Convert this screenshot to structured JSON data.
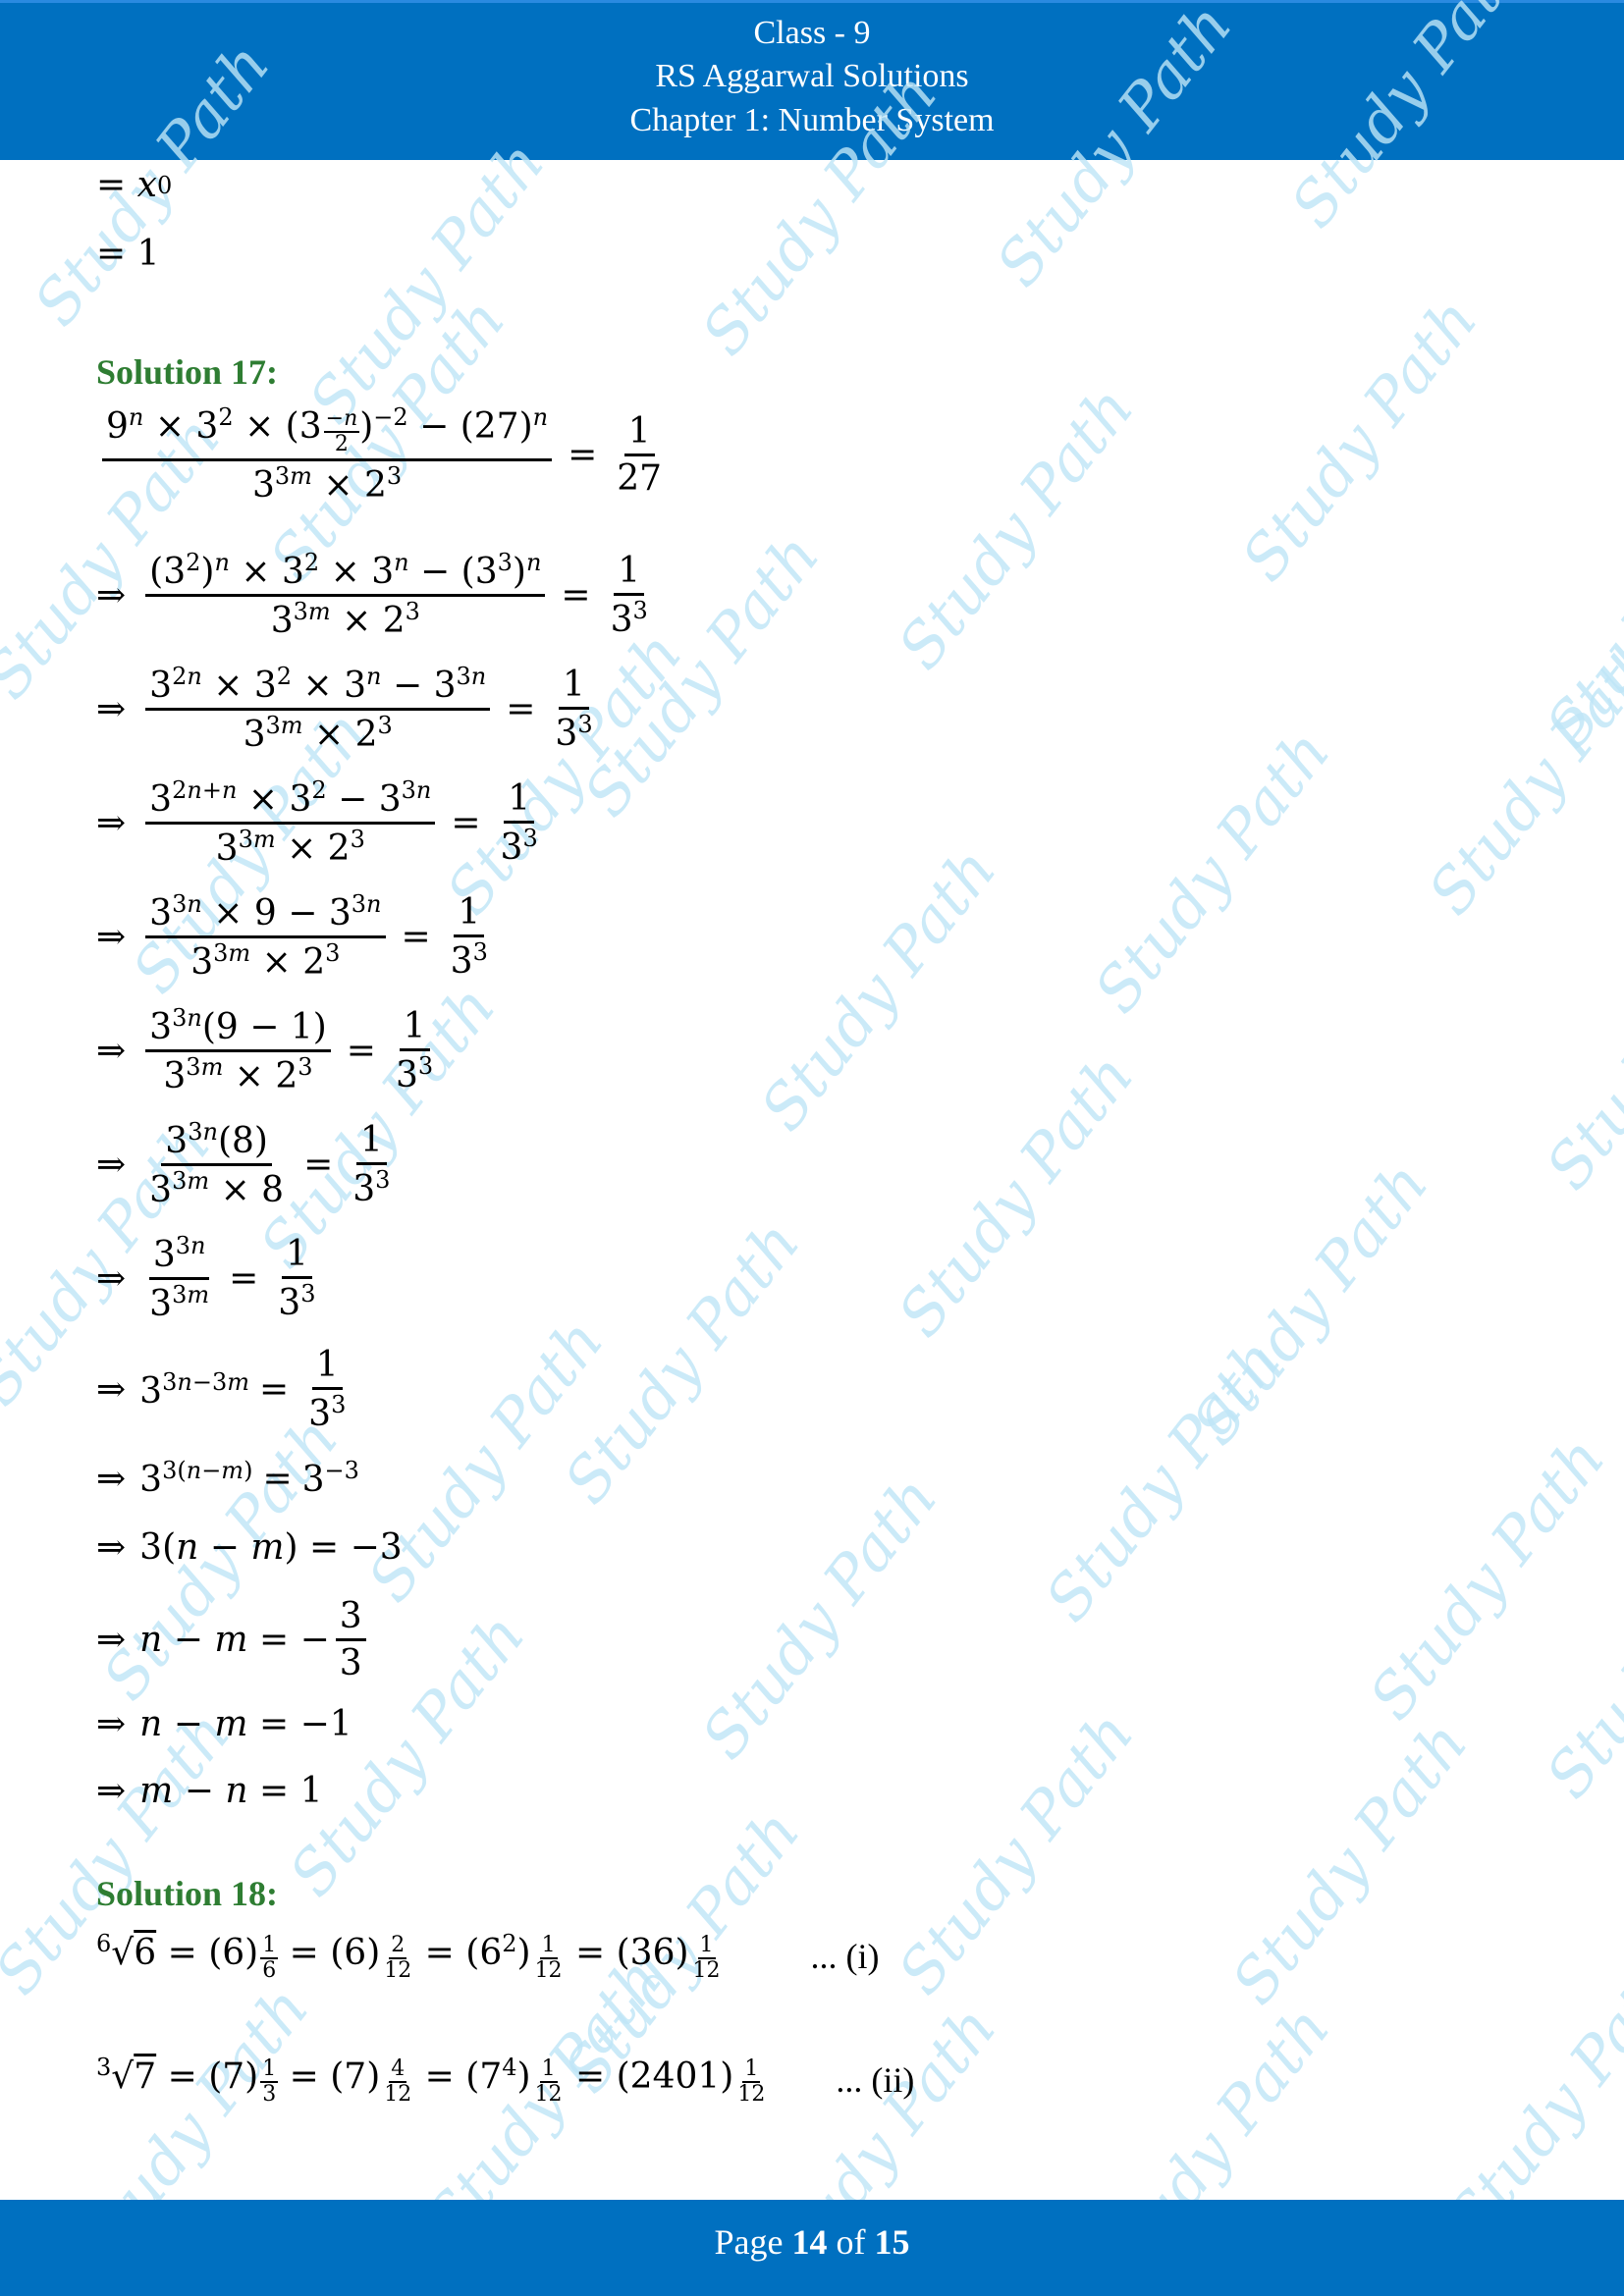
{
  "header": {
    "line1": "Class - 9",
    "line2": "RS Aggarwal Solutions",
    "line3": "Chapter 1: Number System"
  },
  "footer": {
    "prefix": "Page",
    "current_page": "14",
    "separator": "of",
    "total_pages": "15"
  },
  "watermark": {
    "text": "Study Path",
    "color": "#bfe6f7"
  },
  "colors": {
    "header_bg": "#0070c0",
    "solution_heading": "#2e7d32"
  },
  "prev_solution_tail": [
    "= x^0",
    "= 1"
  ],
  "solution17": {
    "heading": "Solution 17:",
    "steps": [
      "(9^n × 3^2 × (3^(−n/2))^(−2) − (27)^n) / (3^(3m) × 2^3) = 1/27",
      "⇒ ((3^2)^n × 3^2 × 3^n − (3^3)^n) / (3^(3m) × 2^3) = 1/3^3",
      "⇒ (3^(2n) × 3^2 × 3^n − 3^(3n)) / (3^(3m) × 2^3) = 1/3^3",
      "⇒ (3^(2n+n) × 3^2 − 3^(3n)) / (3^(3m) × 2^3) = 1/3^3",
      "⇒ (3^(3n) × 9 − 3^(3n)) / (3^(3m) × 2^3) = 1/3^3",
      "⇒ 3^(3n)(9 − 1) / (3^(3m) × 2^3) = 1/3^3",
      "⇒ 3^(3n)(8) / (3^(3m) × 8) = 1/3^3",
      "⇒ 3^(3n) / 3^(3m) = 1/3^3",
      "⇒ 3^(3n−3m) = 1/3^3",
      "⇒ 3^(3(n−m)) = 3^(−3)",
      "⇒ 3(n − m) = −3",
      "⇒ n − m = −3/3",
      "⇒ n − m = −1",
      "⇒ m − n = 1"
    ]
  },
  "solution18": {
    "heading": "Solution 18:",
    "steps": [
      {
        "expr": "⁶√6 = (6)^(1/6) = (6)^(2/12) = (6^2)^(1/12) = (36)^(1/12)",
        "tag": "... (i)"
      },
      {
        "expr": "³√7 = (7)^(1/3) = (7)^(4/12) = (7^4)^(1/12) = (2401)^(1/12)",
        "tag": "... (ii)"
      }
    ]
  }
}
